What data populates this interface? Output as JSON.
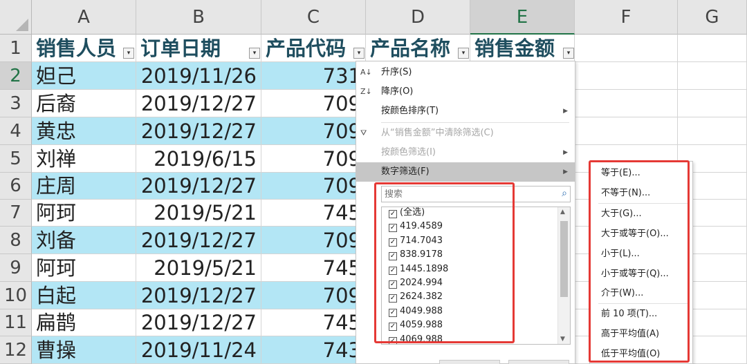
{
  "columns": [
    "A",
    "B",
    "C",
    "D",
    "E",
    "F",
    "G"
  ],
  "selected_column": "E",
  "headers": [
    "销售人员",
    "订单日期",
    "产品代码",
    "产品名称",
    "销售金额"
  ],
  "rows": [
    {
      "num": "1"
    },
    {
      "num": "2",
      "name": "妲己",
      "date": "2019/11/26",
      "code": "731"
    },
    {
      "num": "3",
      "name": "后裔",
      "date": "2019/12/27",
      "code": "709"
    },
    {
      "num": "4",
      "name": "黄忠",
      "date": "2019/12/27",
      "code": "709"
    },
    {
      "num": "5",
      "name": "刘禅",
      "date": "2019/6/15",
      "code": "709"
    },
    {
      "num": "6",
      "name": "庄周",
      "date": "2019/12/27",
      "code": "709"
    },
    {
      "num": "7",
      "name": "阿珂",
      "date": "2019/5/21",
      "code": "745"
    },
    {
      "num": "8",
      "name": "刘备",
      "date": "2019/12/27",
      "code": "709"
    },
    {
      "num": "9",
      "name": "阿珂",
      "date": "2019/5/21",
      "code": "745"
    },
    {
      "num": "10",
      "name": "白起",
      "date": "2019/12/27",
      "code": "709"
    },
    {
      "num": "11",
      "name": "扁鹊",
      "date": "2019/12/27",
      "code": "745"
    },
    {
      "num": "12",
      "name": "曹操",
      "date": "2019/11/24",
      "code": "743"
    }
  ],
  "filter_menu": {
    "sort_asc": "升序(S)",
    "sort_desc": "降序(O)",
    "sort_by_color": "按颜色排序(T)",
    "clear_filter": "从“销售金额”中清除筛选(C)",
    "filter_by_color": "按颜色筛选(I)",
    "number_filter": "数字筛选(F)",
    "search_placeholder": "搜索",
    "values": [
      "(全选)",
      "419.4589",
      "714.7043",
      "838.9178",
      "1445.1898",
      "2024.994",
      "2624.382",
      "4049.988",
      "4059.988",
      "4069.988"
    ]
  },
  "number_filter_submenu": [
    "等于(E)...",
    "不等于(N)...",
    "大于(G)...",
    "大于或等于(O)...",
    "小于(L)...",
    "小于或等于(Q)...",
    "介于(W)...",
    "前 10 项(T)...",
    "高于平均值(A)",
    "低于平均值(O)"
  ],
  "colors": {
    "band": "#b3e6f5",
    "header_text": "#1f4e5f",
    "accent": "#217346",
    "highlight": "#e53935"
  }
}
